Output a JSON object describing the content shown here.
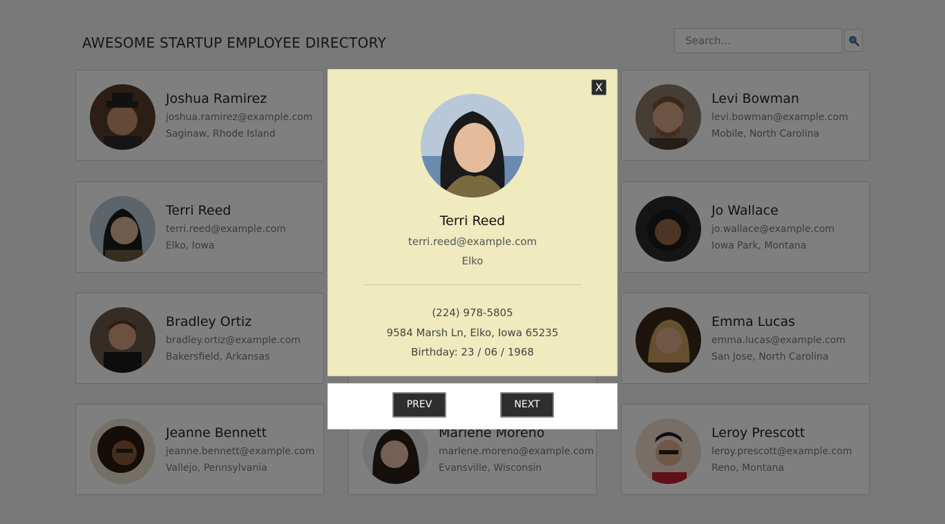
{
  "header": {
    "title": "AWESOME STARTUP EMPLOYEE DIRECTORY",
    "search_placeholder": "Search..."
  },
  "employees": [
    {
      "name": "Joshua Ramirez",
      "email": "joshua.ramirez@example.com",
      "location": "Saginaw, Rhode Island"
    },
    {
      "name": "",
      "email": "",
      "location": ""
    },
    {
      "name": "Levi Bowman",
      "email": "levi.bowman@example.com",
      "location": "Mobile, North Carolina"
    },
    {
      "name": "Terri Reed",
      "email": "terri.reed@example.com",
      "location": "Elko, Iowa"
    },
    {
      "name": "",
      "email": "",
      "location": ""
    },
    {
      "name": "Jo Wallace",
      "email": "jo.wallace@example.com",
      "location": "Iowa Park, Montana"
    },
    {
      "name": "Bradley Ortiz",
      "email": "bradley.ortiz@example.com",
      "location": "Bakersfield, Arkansas"
    },
    {
      "name": "",
      "email": "",
      "location": ""
    },
    {
      "name": "Emma Lucas",
      "email": "emma.lucas@example.com",
      "location": "San Jose, North Carolina"
    },
    {
      "name": "Jeanne Bennett",
      "email": "jeanne.bennett@example.com",
      "location": "Vallejo, Pennsylvania"
    },
    {
      "name": "Marlene Moreno",
      "email": "marlene.moreno@example.com",
      "location": "Evansville, Wisconsin"
    },
    {
      "name": "Leroy Prescott",
      "email": "leroy.prescott@example.com",
      "location": "Reno, Montana"
    }
  ],
  "modal": {
    "close_label": "X",
    "name": "Terri Reed",
    "email": "terri.reed@example.com",
    "city": "Elko",
    "phone": "(224) 978-5805",
    "address": "9584 Marsh Ln, Elko, Iowa 65235",
    "birthday": "Birthday: 23 / 06 / 1968"
  },
  "nav": {
    "prev_label": "PREV",
    "next_label": "NEXT"
  },
  "colors": {
    "modal_bg": "#efebbe",
    "button_bg": "#2e2e2e",
    "overlay": "rgba(0,0,0,0.5)"
  }
}
